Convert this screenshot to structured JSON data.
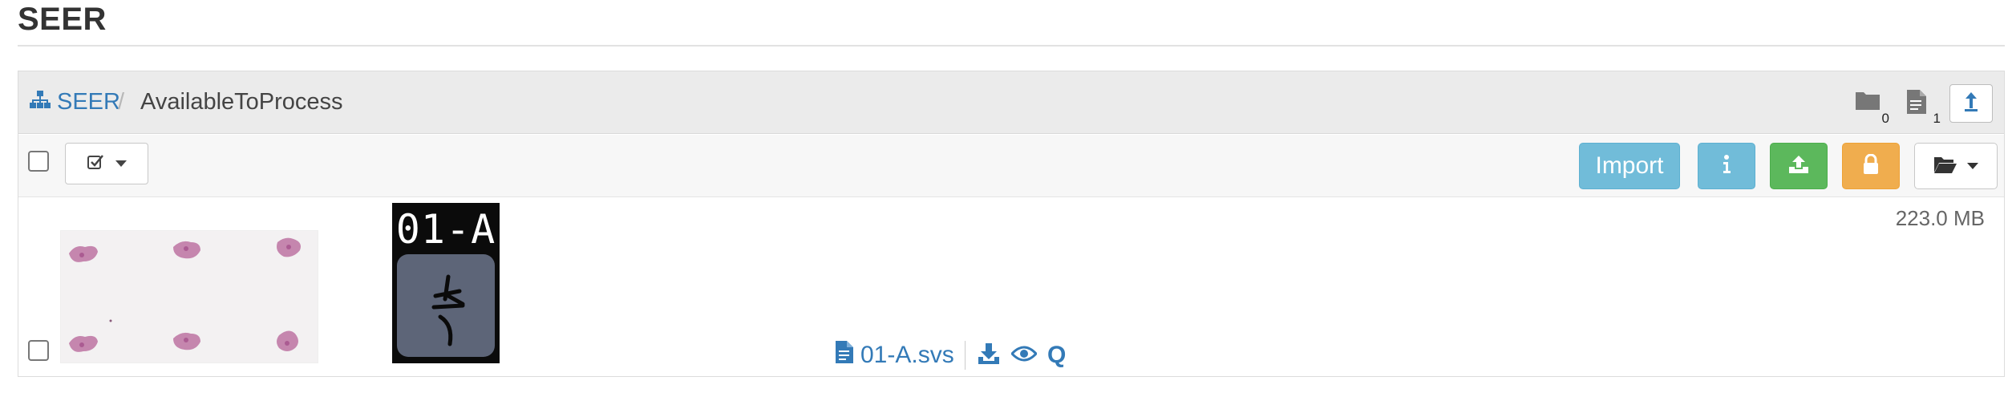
{
  "app_title": "SEER",
  "breadcrumb": {
    "root_label": "SEER",
    "separator": "/",
    "current": "AvailableToProcess"
  },
  "counts": {
    "folders": "0",
    "files": "1"
  },
  "toolbar": {
    "import_label": "Import"
  },
  "item": {
    "filename": "01-A.svs",
    "size": "223.0 MB",
    "label_text": "01-A",
    "handwriting": "1-A",
    "quick_action": "Q"
  },
  "colors": {
    "link": "#337ab7",
    "info_button": "#71bcd9",
    "success_button": "#5cb85c",
    "warning_button": "#f0ad4e",
    "breadcrumb_bar": "#ebebeb"
  },
  "icons": [
    "sitemap-icon",
    "folder-icon",
    "file-icon",
    "upload-arrow-icon",
    "check-square-icon",
    "caret-down-icon",
    "info-icon",
    "upload-icon",
    "lock-icon",
    "folder-open-icon",
    "file-text-icon",
    "download-icon",
    "eye-icon"
  ]
}
